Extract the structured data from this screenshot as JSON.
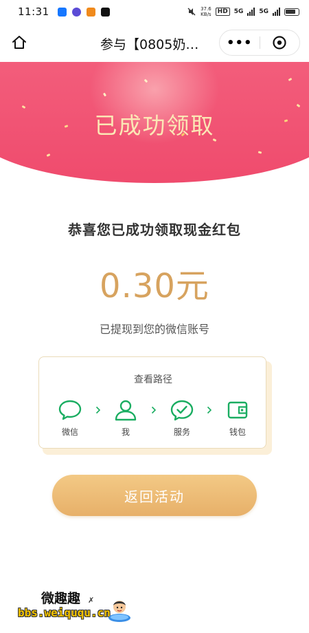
{
  "status_bar": {
    "time": "11:31",
    "net_speed": "37.6",
    "net_unit": "KB/s",
    "hd_label": "HD",
    "network_1": "5G",
    "network_2": "5G"
  },
  "nav": {
    "title": "参与【0805奶…",
    "more_label": "•••"
  },
  "banner": {
    "title": "已成功领取"
  },
  "result": {
    "congrats": "恭喜您已成功领取现金红包",
    "amount": "0.30元",
    "withdrawn_note": "已提现到您的微信账号"
  },
  "path_card": {
    "title": "查看路径",
    "steps": [
      {
        "label": "微信",
        "icon": "chat-bubble-icon"
      },
      {
        "label": "我",
        "icon": "person-icon"
      },
      {
        "label": "服务",
        "icon": "check-bubble-icon"
      },
      {
        "label": "钱包",
        "icon": "wallet-icon"
      }
    ]
  },
  "actions": {
    "back_label": "返回活动"
  },
  "watermark": {
    "title": "微趣趣",
    "url": "bbs.weiququ.cn"
  },
  "colors": {
    "banner": "#ef4b6d",
    "banner_title": "#fbe7b5",
    "amount": "#d7a35f",
    "wechat_green": "#1aad61",
    "button": "#eab66f"
  }
}
